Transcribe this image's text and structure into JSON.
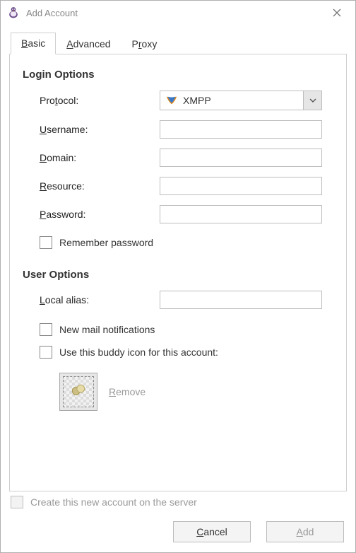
{
  "window": {
    "title": "Add Account"
  },
  "tabs": {
    "basic": "Basic",
    "advanced": "Advanced",
    "proxy": "Proxy",
    "active": "basic"
  },
  "login": {
    "heading": "Login Options",
    "protocol_label": "Protocol:",
    "protocol_selected": "XMPP",
    "username_label": "Username:",
    "username_value": "",
    "domain_label": "Domain:",
    "domain_value": "",
    "resource_label": "Resource:",
    "resource_value": "",
    "password_label": "Password:",
    "password_value": "",
    "remember_label": "Remember password",
    "remember_checked": false
  },
  "user": {
    "heading": "User Options",
    "local_alias_label": "Local alias:",
    "local_alias_value": "",
    "mail_label": "New mail notifications",
    "mail_checked": false,
    "buddy_icon_label": "Use this buddy icon for this account:",
    "buddy_icon_checked": false,
    "remove_label": "Remove"
  },
  "footer": {
    "create_server_label": "Create this new account on the server",
    "create_server_checked": false,
    "cancel_label": "Cancel",
    "add_label": "Add"
  }
}
